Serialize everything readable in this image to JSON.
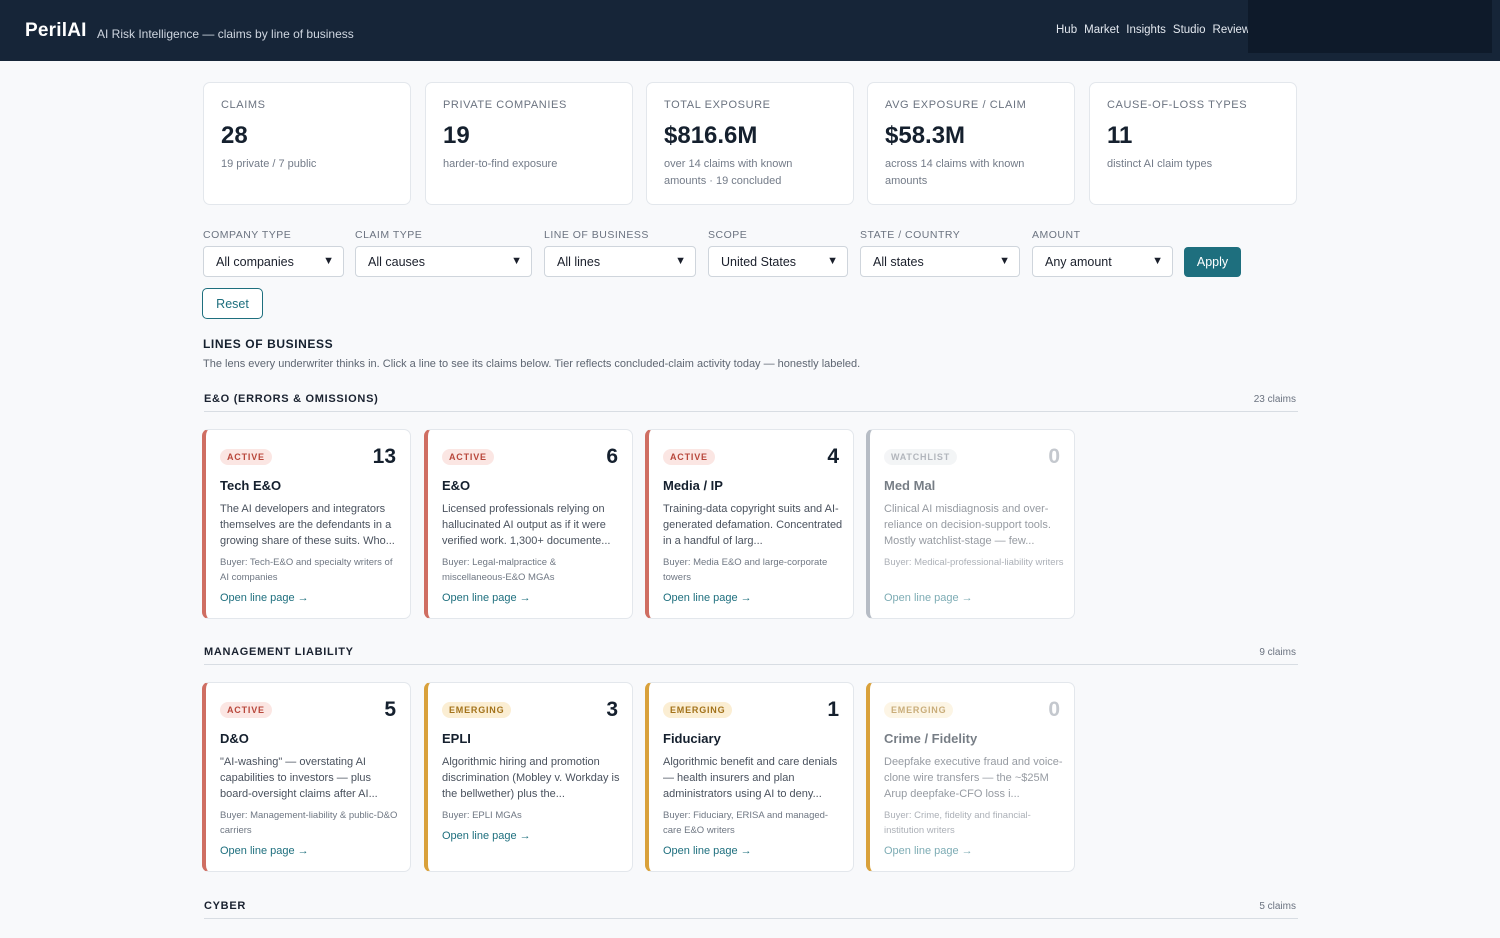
{
  "header": {
    "brand": "PerilAI",
    "tagline": "AI Risk Intelligence — claims by line of business",
    "nav": [
      "Hub",
      "Market",
      "Insights",
      "Studio",
      "Review"
    ]
  },
  "stats": [
    {
      "label": "CLAIMS",
      "value": "28",
      "sub": "19 private / 7 public"
    },
    {
      "label": "PRIVATE COMPANIES",
      "value": "19",
      "sub": "harder-to-find exposure"
    },
    {
      "label": "TOTAL EXPOSURE",
      "value": "$816.6M",
      "sub": "over 14 claims with known amounts · 19 concluded"
    },
    {
      "label": "AVG EXPOSURE / CLAIM",
      "value": "$58.3M",
      "sub": "across 14 claims with known amounts"
    },
    {
      "label": "CAUSE-OF-LOSS TYPES",
      "value": "11",
      "sub": "distinct AI claim types"
    }
  ],
  "filters": {
    "company_type": {
      "label": "COMPANY TYPE",
      "value": "All companies"
    },
    "claim_type": {
      "label": "CLAIM TYPE",
      "value": "All causes"
    },
    "line_of_business": {
      "label": "LINE OF BUSINESS",
      "value": "All lines"
    },
    "scope": {
      "label": "SCOPE",
      "value": "United States"
    },
    "state": {
      "label": "STATE / COUNTRY",
      "value": "All states"
    },
    "amount": {
      "label": "AMOUNT",
      "value": "Any amount"
    },
    "apply_label": "Apply",
    "reset_label": "Reset"
  },
  "lob": {
    "title": "LINES OF BUSINESS",
    "description": "The lens every underwriter thinks in. Click a line to see its claims below. Tier reflects concluded-claim activity today — honestly labeled."
  },
  "sections": [
    {
      "name": "E&O (ERRORS & OMISSIONS)",
      "count": "23 claims",
      "cards": [
        {
          "tier": "ACTIVE",
          "count": "13",
          "name": "Tech E&O",
          "desc": "The AI developers and integrators themselves are the defendants in a growing share of these suits. Who...",
          "buyer": "Buyer: Tech-E&O and specialty writers of AI companies",
          "link": "Open line page →"
        },
        {
          "tier": "ACTIVE",
          "count": "6",
          "name": "E&O",
          "desc": "Licensed professionals relying on hallucinated AI output as if it were verified work. 1,300+ documente...",
          "buyer": "Buyer: Legal-malpractice & miscellaneous-E&O MGAs",
          "link": "Open line page →"
        },
        {
          "tier": "ACTIVE",
          "count": "4",
          "name": "Media / IP",
          "desc": "Training-data copyright suits and AI-generated defamation. Concentrated in a handful of larg...",
          "buyer": "Buyer: Media E&O and large-corporate towers",
          "link": "Open line page →"
        },
        {
          "tier": "WATCHLIST",
          "count": "0",
          "name": "Med Mal",
          "desc": "Clinical AI misdiagnosis and over-reliance on decision-support tools. Mostly watchlist-stage — few...",
          "buyer": "Buyer: Medical-professional-liability writers",
          "link": "Open line page →"
        }
      ]
    },
    {
      "name": "MANAGEMENT LIABILITY",
      "count": "9 claims",
      "cards": [
        {
          "tier": "ACTIVE",
          "count": "5",
          "name": "D&O",
          "desc": "\"AI-washing\" — overstating AI capabilities to investors — plus board-oversight claims after AI...",
          "buyer": "Buyer: Management-liability & public-D&O carriers",
          "link": "Open line page →"
        },
        {
          "tier": "EMERGING",
          "count": "3",
          "name": "EPLI",
          "desc": "Algorithmic hiring and promotion discrimination (Mobley v. Workday is the bellwether) plus the...",
          "buyer": "Buyer: EPLI MGAs",
          "link": "Open line page →"
        },
        {
          "tier": "EMERGING",
          "count": "1",
          "name": "Fiduciary",
          "desc": "Algorithmic benefit and care denials — health insurers and plan administrators using AI to deny...",
          "buyer": "Buyer: Fiduciary, ERISA and managed-care E&O writers",
          "link": "Open line page →"
        },
        {
          "tier": "EMERGING",
          "count": "0",
          "name": "Crime / Fidelity",
          "desc": "Deepfake executive fraud and voice-clone wire transfers — the ~$25M Arup deepfake-CFO loss i...",
          "buyer": "Buyer: Crime, fidelity and financial-institution writers",
          "link": "Open line page →"
        }
      ]
    },
    {
      "name": "CYBER",
      "count": "5 claims",
      "cards": []
    }
  ],
  "colors": {
    "header": "#162538",
    "accent": "#1e6f7e",
    "active": "#cf6e62",
    "emerging": "#d9a13b",
    "watchlist": "#b6bcc5"
  }
}
